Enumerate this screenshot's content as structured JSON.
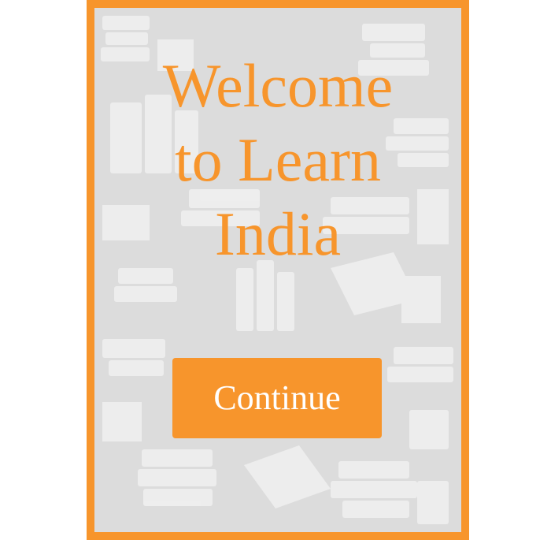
{
  "welcome": {
    "title_lines": [
      "Welcome",
      "to Learn",
      "India"
    ]
  },
  "actions": {
    "continue_label": "Continue"
  },
  "theme": {
    "accent": "#f7952c",
    "panel_background": "#dcdcdc",
    "pattern_color": "#eeeeee",
    "button_text": "#ffffff"
  },
  "background": {
    "pattern_icon": "books-pattern-icon"
  }
}
